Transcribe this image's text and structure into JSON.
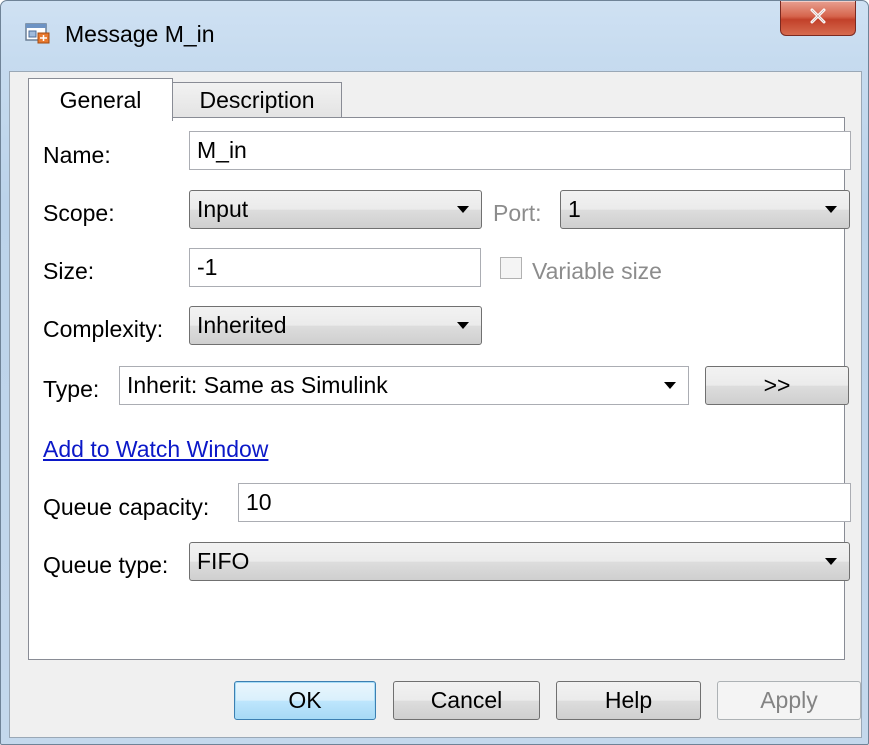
{
  "window": {
    "title": "Message M_in",
    "close_glyph": "X",
    "frame_color": "#c6dbef",
    "close_color": "#c2412a"
  },
  "tabs": [
    {
      "label": "General",
      "active": true
    },
    {
      "label": "Description",
      "active": false
    }
  ],
  "general": {
    "name_label": "Name:",
    "name_value": "M_in",
    "scope_label": "Scope:",
    "scope_value": "Input",
    "port_label": "Port:",
    "port_value": "1",
    "size_label": "Size:",
    "size_value": "-1",
    "variable_size_label": "Variable size",
    "variable_size_checked": false,
    "complexity_label": "Complexity:",
    "complexity_value": "Inherited",
    "type_label": "Type:",
    "type_value": "Inherit: Same as Simulink",
    "type_button_label": ">>",
    "watch_link": "Add to Watch Window",
    "link_color": "#0b18c8",
    "queue_capacity_label": "Queue capacity:",
    "queue_capacity_value": "10",
    "queue_type_label": "Queue type:",
    "queue_type_value": "FIFO"
  },
  "buttons": {
    "ok": "OK",
    "cancel": "Cancel",
    "help": "Help",
    "apply": "Apply",
    "apply_enabled": false
  },
  "icons": {
    "app": "stateflow-message-icon",
    "dropdown": "chevron-down-icon",
    "close": "close-icon"
  }
}
